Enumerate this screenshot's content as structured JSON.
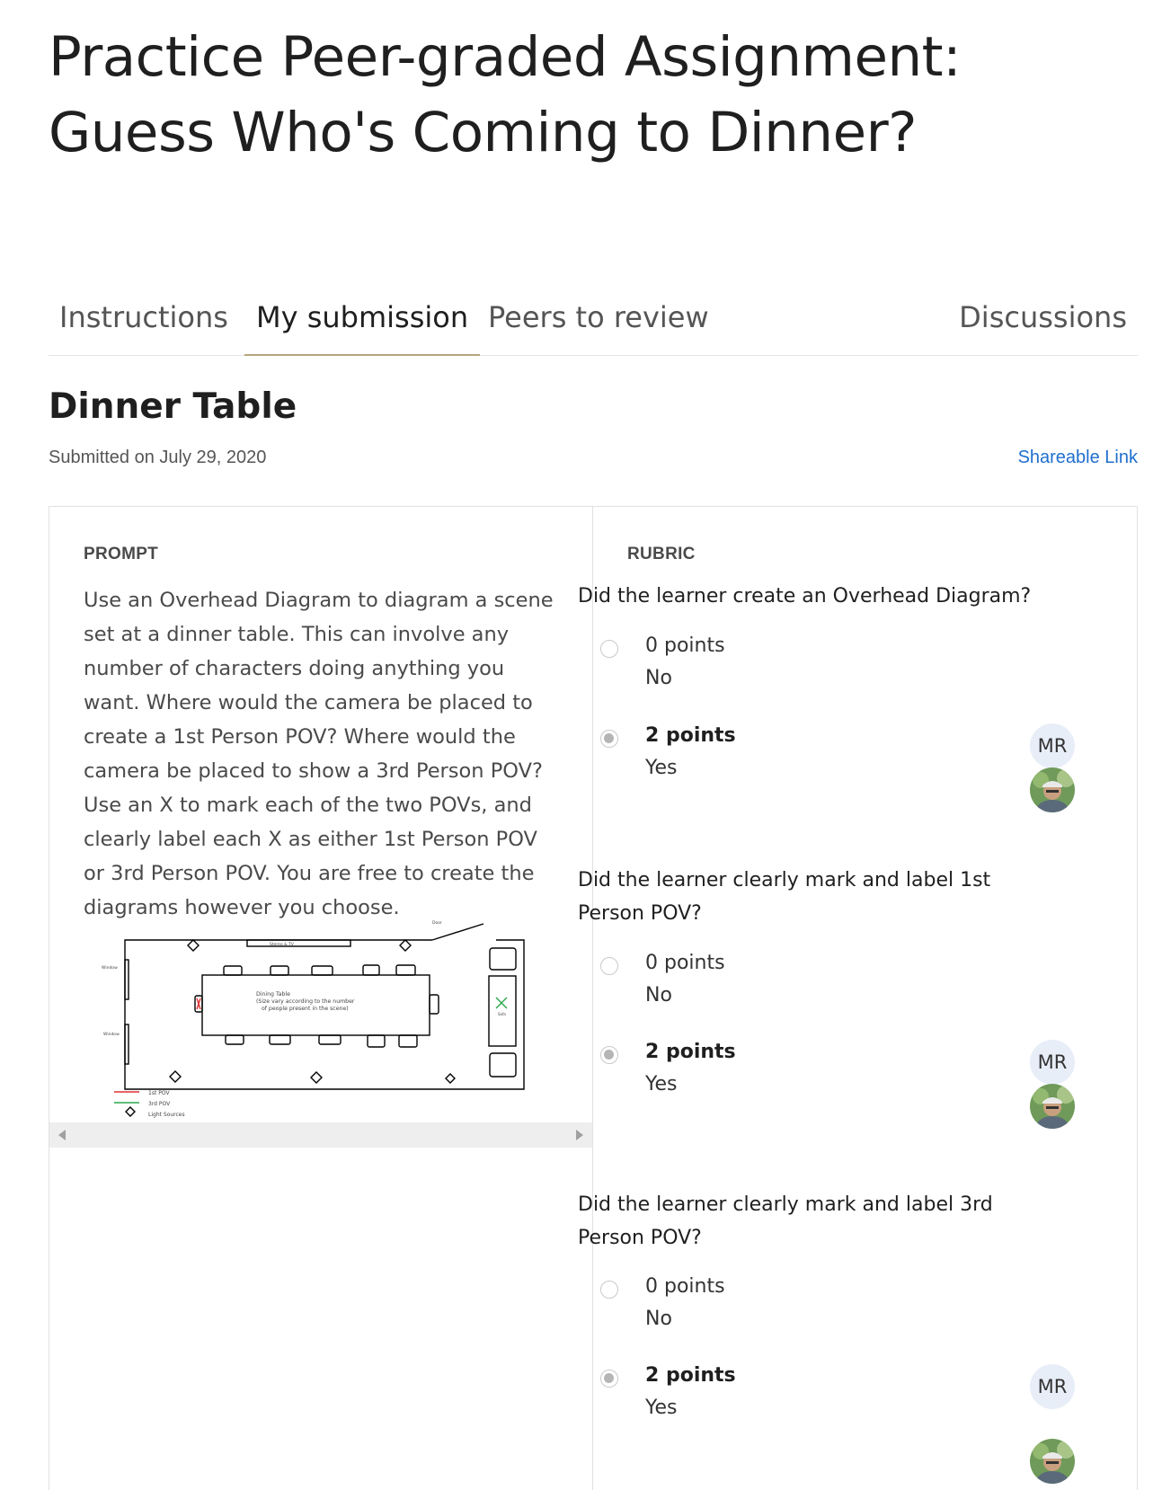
{
  "page": {
    "title": "Practice Peer-graded Assignment: Guess Who's Coming to Dinner?"
  },
  "tabs": [
    {
      "label": "Instructions"
    },
    {
      "label": "My submission"
    },
    {
      "label": "Peers to review"
    },
    {
      "label": "Discussions"
    }
  ],
  "submission": {
    "title": "Dinner Table",
    "date": "Submitted on July 29, 2020",
    "share_link": "Shareable Link"
  },
  "prompt": {
    "label": "PROMPT",
    "text": "Use an Overhead Diagram to diagram a scene set at a dinner table. This can involve any number of characters doing anything you want. Where would the camera be placed to create a 1st Person POV? Where would the camera be placed to show a 3rd Person POV? Use an X to mark each of the two POVs, and clearly label each X as either 1st Person POV or 3rd Person POV. You are free to create the diagrams however you choose."
  },
  "diagram": {
    "door": "Door",
    "tv": "Stereo & TV",
    "window1": "Window",
    "window2": "Window",
    "table_line1": "Dining Table",
    "table_line2": "(Size vary according to the number",
    "table_line3": "of people present in the scene)",
    "sofa": "Sofa",
    "legend_1st": "1st POV",
    "legend_3rd": "3rd POV",
    "legend_light": "Light Sources",
    "colors": {
      "pov1": "#e03030",
      "pov3": "#2aa84a"
    }
  },
  "rubric": {
    "label": "RUBRIC",
    "criteria": [
      {
        "question": "Did the learner create an Overhead Diagram?",
        "options": [
          {
            "points": "0 points",
            "desc": "No"
          },
          {
            "points": "2 points",
            "desc": "Yes"
          }
        ],
        "grader": "MR"
      },
      {
        "question": "Did the learner clearly mark and label 1st Person POV?",
        "options": [
          {
            "points": "0 points",
            "desc": "No"
          },
          {
            "points": "2 points",
            "desc": "Yes"
          }
        ],
        "grader": "MR"
      },
      {
        "question": "Did the learner clearly mark and label 3rd Person POV?",
        "options": [
          {
            "points": "0 points",
            "desc": "No"
          },
          {
            "points": "2 points",
            "desc": "Yes"
          }
        ],
        "grader": "MR"
      }
    ]
  }
}
